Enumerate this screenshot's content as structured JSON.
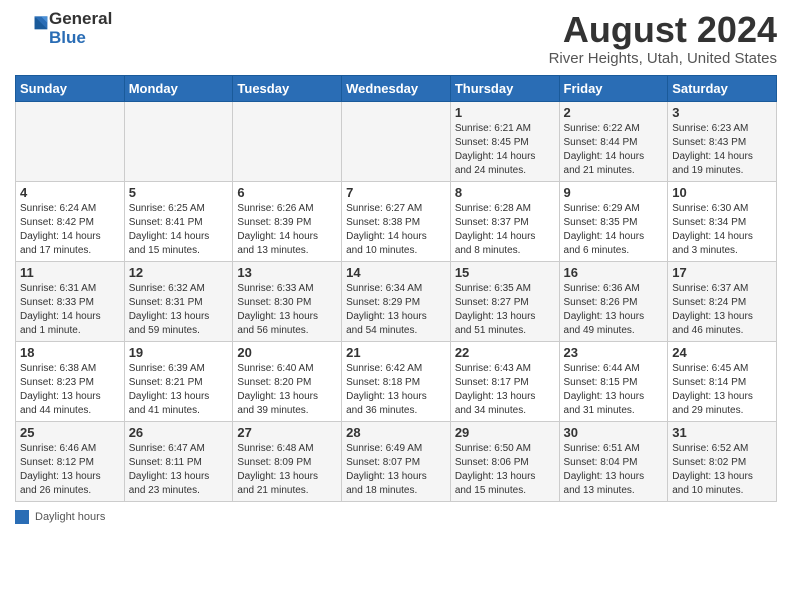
{
  "header": {
    "logo": {
      "general": "General",
      "blue": "Blue"
    },
    "title": "August 2024",
    "location": "River Heights, Utah, United States"
  },
  "days_of_week": [
    "Sunday",
    "Monday",
    "Tuesday",
    "Wednesday",
    "Thursday",
    "Friday",
    "Saturday"
  ],
  "weeks": [
    [
      {
        "day": "",
        "info": ""
      },
      {
        "day": "",
        "info": ""
      },
      {
        "day": "",
        "info": ""
      },
      {
        "day": "",
        "info": ""
      },
      {
        "day": "1",
        "info": "Sunrise: 6:21 AM\nSunset: 8:45 PM\nDaylight: 14 hours and 24 minutes."
      },
      {
        "day": "2",
        "info": "Sunrise: 6:22 AM\nSunset: 8:44 PM\nDaylight: 14 hours and 21 minutes."
      },
      {
        "day": "3",
        "info": "Sunrise: 6:23 AM\nSunset: 8:43 PM\nDaylight: 14 hours and 19 minutes."
      }
    ],
    [
      {
        "day": "4",
        "info": "Sunrise: 6:24 AM\nSunset: 8:42 PM\nDaylight: 14 hours and 17 minutes."
      },
      {
        "day": "5",
        "info": "Sunrise: 6:25 AM\nSunset: 8:41 PM\nDaylight: 14 hours and 15 minutes."
      },
      {
        "day": "6",
        "info": "Sunrise: 6:26 AM\nSunset: 8:39 PM\nDaylight: 14 hours and 13 minutes."
      },
      {
        "day": "7",
        "info": "Sunrise: 6:27 AM\nSunset: 8:38 PM\nDaylight: 14 hours and 10 minutes."
      },
      {
        "day": "8",
        "info": "Sunrise: 6:28 AM\nSunset: 8:37 PM\nDaylight: 14 hours and 8 minutes."
      },
      {
        "day": "9",
        "info": "Sunrise: 6:29 AM\nSunset: 8:35 PM\nDaylight: 14 hours and 6 minutes."
      },
      {
        "day": "10",
        "info": "Sunrise: 6:30 AM\nSunset: 8:34 PM\nDaylight: 14 hours and 3 minutes."
      }
    ],
    [
      {
        "day": "11",
        "info": "Sunrise: 6:31 AM\nSunset: 8:33 PM\nDaylight: 14 hours and 1 minute."
      },
      {
        "day": "12",
        "info": "Sunrise: 6:32 AM\nSunset: 8:31 PM\nDaylight: 13 hours and 59 minutes."
      },
      {
        "day": "13",
        "info": "Sunrise: 6:33 AM\nSunset: 8:30 PM\nDaylight: 13 hours and 56 minutes."
      },
      {
        "day": "14",
        "info": "Sunrise: 6:34 AM\nSunset: 8:29 PM\nDaylight: 13 hours and 54 minutes."
      },
      {
        "day": "15",
        "info": "Sunrise: 6:35 AM\nSunset: 8:27 PM\nDaylight: 13 hours and 51 minutes."
      },
      {
        "day": "16",
        "info": "Sunrise: 6:36 AM\nSunset: 8:26 PM\nDaylight: 13 hours and 49 minutes."
      },
      {
        "day": "17",
        "info": "Sunrise: 6:37 AM\nSunset: 8:24 PM\nDaylight: 13 hours and 46 minutes."
      }
    ],
    [
      {
        "day": "18",
        "info": "Sunrise: 6:38 AM\nSunset: 8:23 PM\nDaylight: 13 hours and 44 minutes."
      },
      {
        "day": "19",
        "info": "Sunrise: 6:39 AM\nSunset: 8:21 PM\nDaylight: 13 hours and 41 minutes."
      },
      {
        "day": "20",
        "info": "Sunrise: 6:40 AM\nSunset: 8:20 PM\nDaylight: 13 hours and 39 minutes."
      },
      {
        "day": "21",
        "info": "Sunrise: 6:42 AM\nSunset: 8:18 PM\nDaylight: 13 hours and 36 minutes."
      },
      {
        "day": "22",
        "info": "Sunrise: 6:43 AM\nSunset: 8:17 PM\nDaylight: 13 hours and 34 minutes."
      },
      {
        "day": "23",
        "info": "Sunrise: 6:44 AM\nSunset: 8:15 PM\nDaylight: 13 hours and 31 minutes."
      },
      {
        "day": "24",
        "info": "Sunrise: 6:45 AM\nSunset: 8:14 PM\nDaylight: 13 hours and 29 minutes."
      }
    ],
    [
      {
        "day": "25",
        "info": "Sunrise: 6:46 AM\nSunset: 8:12 PM\nDaylight: 13 hours and 26 minutes."
      },
      {
        "day": "26",
        "info": "Sunrise: 6:47 AM\nSunset: 8:11 PM\nDaylight: 13 hours and 23 minutes."
      },
      {
        "day": "27",
        "info": "Sunrise: 6:48 AM\nSunset: 8:09 PM\nDaylight: 13 hours and 21 minutes."
      },
      {
        "day": "28",
        "info": "Sunrise: 6:49 AM\nSunset: 8:07 PM\nDaylight: 13 hours and 18 minutes."
      },
      {
        "day": "29",
        "info": "Sunrise: 6:50 AM\nSunset: 8:06 PM\nDaylight: 13 hours and 15 minutes."
      },
      {
        "day": "30",
        "info": "Sunrise: 6:51 AM\nSunset: 8:04 PM\nDaylight: 13 hours and 13 minutes."
      },
      {
        "day": "31",
        "info": "Sunrise: 6:52 AM\nSunset: 8:02 PM\nDaylight: 13 hours and 10 minutes."
      }
    ]
  ],
  "legend": {
    "label": "Daylight hours"
  }
}
